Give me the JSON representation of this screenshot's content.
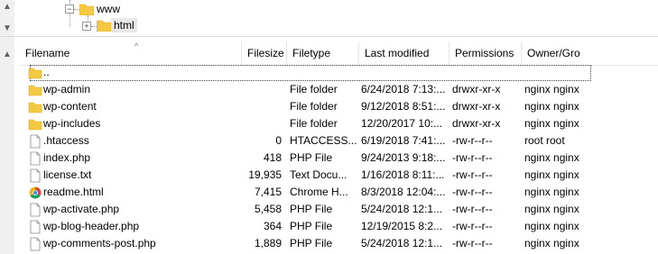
{
  "tree": {
    "nodes": [
      {
        "label": "www",
        "expander": "−"
      },
      {
        "label": "html",
        "expander": "+"
      }
    ]
  },
  "scrollbar": {
    "up_glyph": "▲",
    "down_glyph": "▼"
  },
  "columns": {
    "filename": "Filename",
    "filesize": "Filesize",
    "filetype": "Filetype",
    "last_modified": "Last modified",
    "permissions": "Permissions",
    "owner": "Owner/Gro"
  },
  "files": [
    {
      "name": "..",
      "size": "",
      "type": "",
      "modified": "",
      "permissions": "",
      "owner": "",
      "icon": "folder-icon"
    },
    {
      "name": "wp-admin",
      "size": "",
      "type": "File folder",
      "modified": "6/24/2018 7:13:...",
      "permissions": "drwxr-xr-x",
      "owner": "nginx nginx",
      "icon": "folder-icon"
    },
    {
      "name": "wp-content",
      "size": "",
      "type": "File folder",
      "modified": "9/12/2018 8:51:...",
      "permissions": "drwxr-xr-x",
      "owner": "nginx nginx",
      "icon": "folder-icon"
    },
    {
      "name": "wp-includes",
      "size": "",
      "type": "File folder",
      "modified": "12/20/2017 10:...",
      "permissions": "drwxr-xr-x",
      "owner": "nginx nginx",
      "icon": "folder-icon"
    },
    {
      "name": ".htaccess",
      "size": "0",
      "type": "HTACCESS...",
      "modified": "6/19/2018 7:41:...",
      "permissions": "-rw-r--r--",
      "owner": "root root",
      "icon": "file-icon"
    },
    {
      "name": "index.php",
      "size": "418",
      "type": "PHP File",
      "modified": "9/24/2013 9:18:...",
      "permissions": "-rw-r--r--",
      "owner": "nginx nginx",
      "icon": "file-icon"
    },
    {
      "name": "license.txt",
      "size": "19,935",
      "type": "Text Docu...",
      "modified": "1/16/2018 8:11:...",
      "permissions": "-rw-r--r--",
      "owner": "nginx nginx",
      "icon": "file-icon"
    },
    {
      "name": "readme.html",
      "size": "7,415",
      "type": "Chrome H...",
      "modified": "8/3/2018 12:04:...",
      "permissions": "-rw-r--r--",
      "owner": "nginx nginx",
      "icon": "chrome-icon"
    },
    {
      "name": "wp-activate.php",
      "size": "5,458",
      "type": "PHP File",
      "modified": "5/24/2018 12:1...",
      "permissions": "-rw-r--r--",
      "owner": "nginx nginx",
      "icon": "file-icon"
    },
    {
      "name": "wp-blog-header.php",
      "size": "364",
      "type": "PHP File",
      "modified": "12/19/2015 8:2...",
      "permissions": "-rw-r--r--",
      "owner": "nginx nginx",
      "icon": "file-icon"
    },
    {
      "name": "wp-comments-post.php",
      "size": "1,889",
      "type": "PHP File",
      "modified": "5/24/2018 12:1...",
      "permissions": "-rw-r--r--",
      "owner": "nginx nginx",
      "icon": "file-icon"
    }
  ],
  "colors": {
    "folder": "#f5c842",
    "folder_dark": "#dcab23",
    "header_border": "#e5e5e5"
  }
}
